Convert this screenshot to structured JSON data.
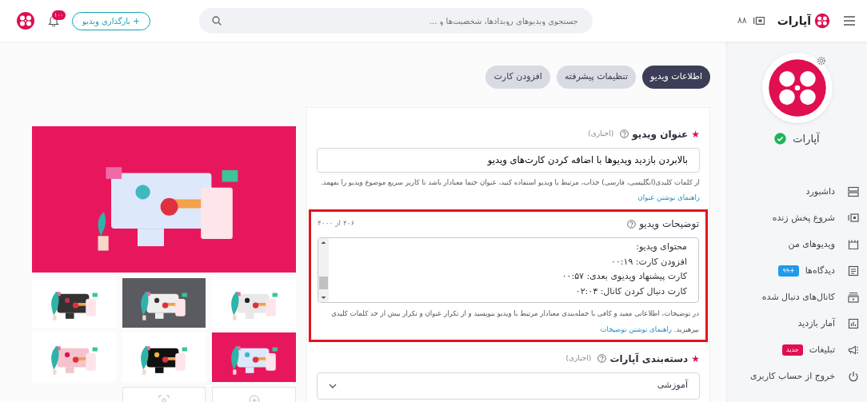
{
  "header": {
    "logo_text": "آپارات",
    "live_count": "۸۸",
    "search": {
      "placeholder": "جستجوی ویدیوهای رویدادها، شخصیت‌ها و ..."
    },
    "upload_button": "+ بارگذاری ویدیو",
    "notification_badge": "۱۰۰"
  },
  "sidebar": {
    "channel_name": "آپارات",
    "verified": true,
    "items": [
      {
        "label": "داشبورد"
      },
      {
        "label": "شروع پخش زنده"
      },
      {
        "label": "ویدیوهای من"
      },
      {
        "label": "دیدگاه‌ها",
        "badge": {
          "text": "+۹۹",
          "color": "#1e9bea"
        }
      },
      {
        "label": "کانال‌های دنبال شده"
      },
      {
        "label": "آمار بازدید"
      },
      {
        "label": "تبلیغات",
        "badge": {
          "text": "جدید",
          "color": "#df0f50"
        }
      },
      {
        "label": "خروج از حساب کاربری"
      }
    ]
  },
  "tabs": [
    {
      "label": "اطلاعات ویدیو",
      "selected": true
    },
    {
      "label": "تنظیمات پیشرفته",
      "selected": false
    },
    {
      "label": "افزودن کارت",
      "selected": false
    }
  ],
  "form": {
    "title_field": {
      "required_mark": "★",
      "label": "عنوان ویدیو",
      "note": "(اجباری)",
      "value": "بالابردن بازدید ویدیوها با اضافه کردن کارت‌های ویدیو",
      "help": "از کلمات کلیدی(انگلیسی، فارسی) جذاب، مرتبط با ویدیو استفاده کنید، عنوان حتما معنادار باشد تا کاربر سریع موضوع ویدیو را بفهمد.",
      "help_link": "راهنمای نوشتن عنوان"
    },
    "description_field": {
      "highlighted": true,
      "label": "توضیحات ویدیو",
      "counter": "۴۰۶ از ۴۰۰۰",
      "lines": [
        "محتوای ویدیو:",
        "افزودن کارت: ۰۰:۱۹",
        "کارت پیشنهاد ویدیوی بعدی: ۰۰:۵۷",
        "کارت دنبال کردن کانال: ۰۲:۰۳"
      ],
      "help": "در توضیحات، اطلاعاتی مفید و کافی با جمله‌بندی معنادار مرتبط با ویدیو بنویسید و از تکرار عنوان و تکرار بیش از حد کلمات کلیدی بپرهیزید.",
      "help_link": "راهنمای نوشتن توضیحات"
    },
    "category_field": {
      "required_mark": "★",
      "label": "دسته‌بندی آپارات",
      "note": "(اجباری)",
      "value": "آموزشی"
    }
  },
  "cover": {
    "kind": "picture"
  },
  "thumbnails": [
    {
      "kind": "picture"
    },
    {
      "kind": "picture"
    },
    {
      "kind": "picture"
    },
    {
      "kind": "picture"
    },
    {
      "kind": "picture"
    },
    {
      "kind": "picture"
    },
    {
      "kind": "add"
    },
    {
      "kind": "capture"
    }
  ]
}
